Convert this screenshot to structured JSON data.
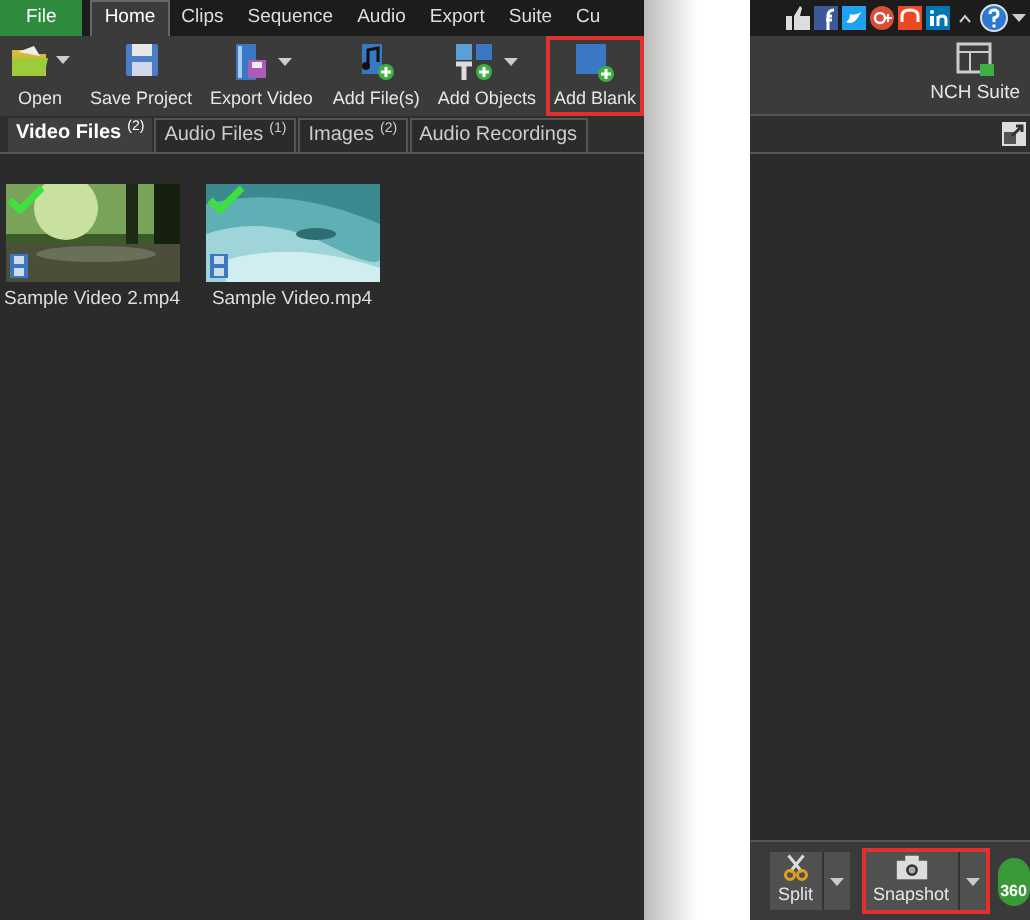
{
  "menu_tabs": [
    {
      "label": "File",
      "kind": "file",
      "selected": false
    },
    {
      "label": "Home",
      "kind": "tab",
      "selected": true
    },
    {
      "label": "Clips",
      "kind": "tab",
      "selected": false
    },
    {
      "label": "Sequence",
      "kind": "tab",
      "selected": false
    },
    {
      "label": "Audio",
      "kind": "tab",
      "selected": false
    },
    {
      "label": "Export",
      "kind": "tab",
      "selected": false
    },
    {
      "label": "Suite",
      "kind": "tab",
      "selected": false
    },
    {
      "label": "Cu",
      "kind": "tab",
      "selected": false
    }
  ],
  "ribbon": [
    {
      "label": "Open",
      "kind": "open",
      "dropdown": true,
      "highlighted": false
    },
    {
      "label": "Save Project",
      "kind": "save",
      "dropdown": false,
      "highlighted": false
    },
    {
      "label": "Export Video",
      "kind": "export",
      "dropdown": true,
      "highlighted": false
    },
    {
      "label": "Add File(s)",
      "kind": "add-file",
      "dropdown": false,
      "highlighted": false
    },
    {
      "label": "Add Objects",
      "kind": "add-objects",
      "dropdown": true,
      "highlighted": false
    },
    {
      "label": "Add Blank",
      "kind": "add-blank",
      "dropdown": false,
      "highlighted": true
    }
  ],
  "media_tabs": [
    {
      "label": "Video Files",
      "count": "(2)",
      "selected": true
    },
    {
      "label": "Audio Files",
      "count": "(1)",
      "selected": false
    },
    {
      "label": "Images",
      "count": "(2)",
      "selected": false
    },
    {
      "label": "Audio Recordings",
      "selected": false
    }
  ],
  "media_items": [
    {
      "caption": "Sample Video 2.mp4",
      "kind": "picture",
      "checked": true
    },
    {
      "caption": "Sample Video.mp4",
      "kind": "picture",
      "checked": true
    }
  ],
  "suite_button": {
    "label": "NCH Suite"
  },
  "preview_toolbar": [
    {
      "label": "Split",
      "kind": "split",
      "dropdown": true,
      "highlighted": false
    },
    {
      "label": "Snapshot",
      "kind": "snapshot",
      "dropdown": true,
      "highlighted": true
    },
    {
      "label": "360",
      "kind": "vr",
      "dropdown": false,
      "highlighted": false
    }
  ]
}
